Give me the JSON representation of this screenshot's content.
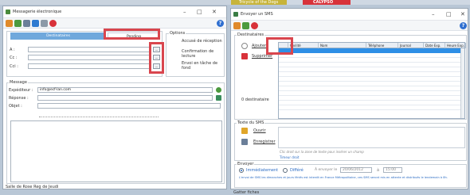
{
  "topstrip": {
    "tab_left": "Tricycle of the Dogs",
    "tab_right": "CALYPSO"
  },
  "left_window": {
    "title": "Messagerie électronique",
    "controls": {
      "minimize": "–",
      "maximize": "□",
      "close": "✕"
    },
    "help": "?",
    "tabs": {
      "destinataires": "Destinataires",
      "pending": "Pending"
    },
    "recipients": {
      "a_label": "A :",
      "cc_label": "Cc :",
      "cci_label": "Cci :",
      "button": "..."
    },
    "options": {
      "title": "Options",
      "accuse": "Accusé de réception",
      "confirmation": "Confirmation de lecture",
      "envoi": "Envoi en tâche de fond"
    },
    "message": {
      "title": "Message",
      "expediteur_label": "Expéditeur :",
      "expediteur_value": "info@ecf-lan.com",
      "reponse_label": "Réponse :",
      "objet_label": "Objet :"
    },
    "status": "Salle de Rose Reg de Jeudi"
  },
  "right_window": {
    "title": "Envoyer un SMS",
    "controls": {
      "minimize": "–",
      "maximize": "□",
      "close": "✕"
    },
    "help": "?",
    "dest_group_title": "Destinataires",
    "add_button": "Ajouter",
    "remove_button": "Supprimer",
    "count_label": "0 destinataire",
    "grid_headers": [
      "",
      "Civilité",
      "Nom",
      "Téléphone",
      "Journal",
      "Date Exp.",
      "Heure Exp."
    ],
    "texte_group_title": "Texte du SMS",
    "ouvrir": "Ouvrir",
    "enregistrer": "Enregistrer",
    "hint": "Clic droit sur la zone de texte pour insérer un champ",
    "timer": "Timeur droit",
    "envoi_group_title": "Envoyer",
    "immediatement": "Immédiatement",
    "differe": "Différé",
    "envoyer_le": "À envoyer le",
    "date": "20/06/2012",
    "a": "à",
    "time": "15:00",
    "note": "L'envoi de SMS les dimanches et jours fériés est interdit en France Métropolitaine, ces SMS seront mis en attente et distribués le lendemain à 8h.",
    "status": "Gatter fiches"
  }
}
